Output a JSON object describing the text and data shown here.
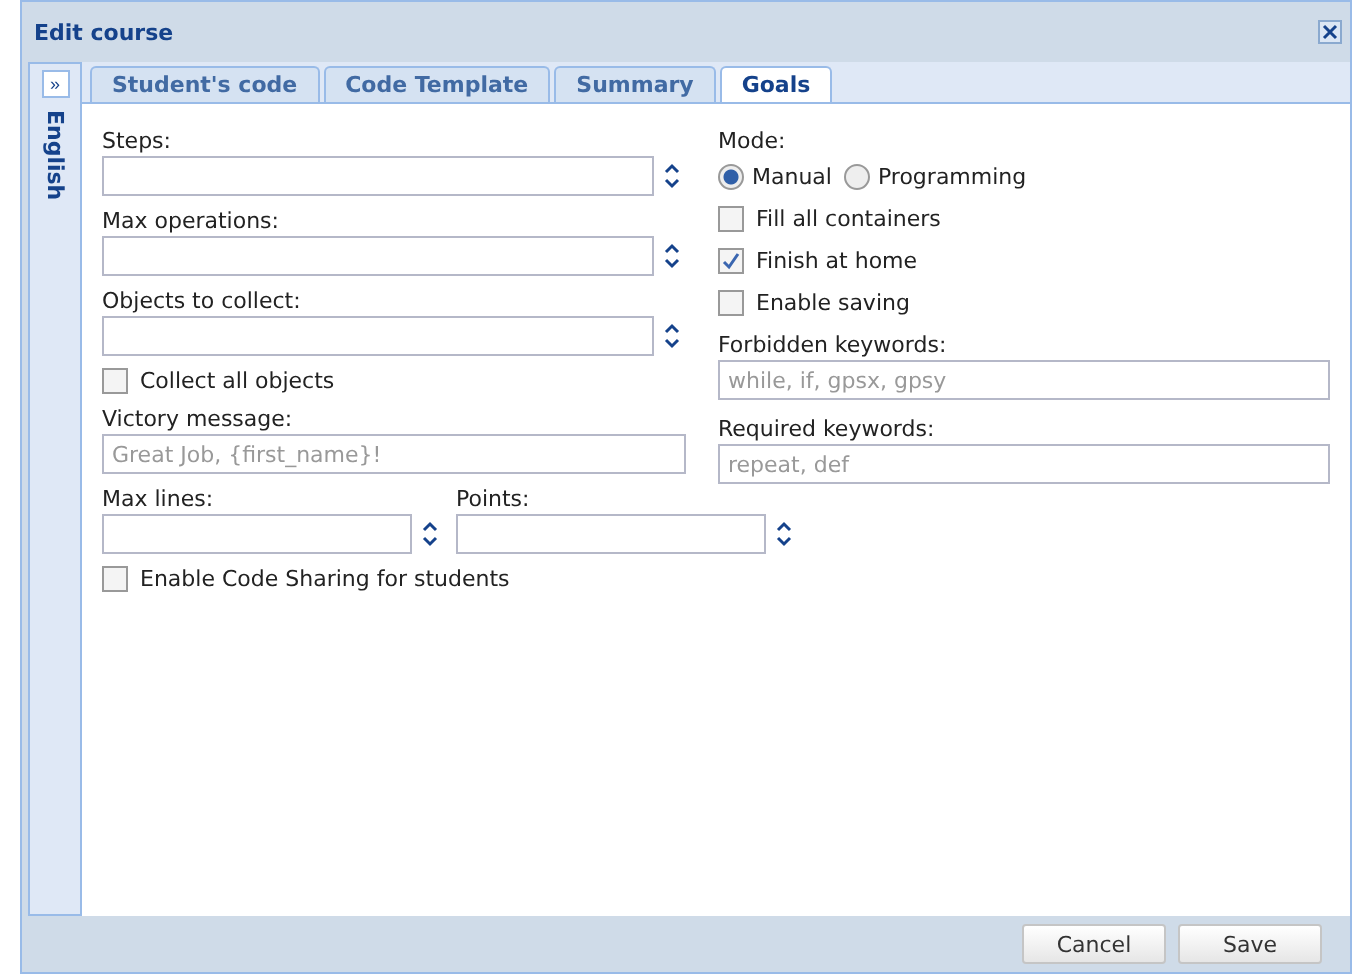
{
  "window": {
    "title": "Edit course"
  },
  "side_panel": {
    "toggle": "»",
    "label": "English"
  },
  "tabs": [
    {
      "label": "Student's code",
      "selected": false
    },
    {
      "label": "Code Template",
      "selected": false
    },
    {
      "label": "Summary",
      "selected": false
    },
    {
      "label": "Goals",
      "selected": true
    }
  ],
  "left_column": [
    {
      "kind": "spinner",
      "label": "Steps:"
    },
    {
      "kind": "spinner",
      "label": "Max operations:"
    },
    {
      "kind": "spinner",
      "label": "Objects to collect:"
    },
    {
      "kind": "checkbox",
      "label": "Collect all objects",
      "checked": false
    },
    {
      "kind": "text",
      "label": "Victory message:",
      "placeholder": "Great Job, {first_name}!"
    },
    {
      "kind": "spinner_pair",
      "items": [
        {
          "label": "Max lines:"
        },
        {
          "label": "Points:"
        }
      ]
    },
    {
      "kind": "checkbox",
      "label": "Enable Code Sharing for students",
      "checked": false
    }
  ],
  "right_column": [
    {
      "kind": "radio",
      "label": "Mode:",
      "options": [
        {
          "label": "Manual",
          "selected": true
        },
        {
          "label": "Programming",
          "selected": false
        }
      ]
    },
    {
      "kind": "checkbox",
      "label": "Fill all containers",
      "checked": false
    },
    {
      "kind": "checkbox",
      "label": "Finish at home",
      "checked": true
    },
    {
      "kind": "checkbox",
      "label": "Enable saving",
      "checked": false
    },
    {
      "kind": "text",
      "label": "Forbidden keywords:",
      "placeholder": "while, if, gpsx, gpsy"
    },
    {
      "kind": "text",
      "label": "Required keywords:",
      "placeholder": "repeat, def"
    }
  ],
  "buttons": [
    "Cancel",
    "Save"
  ]
}
